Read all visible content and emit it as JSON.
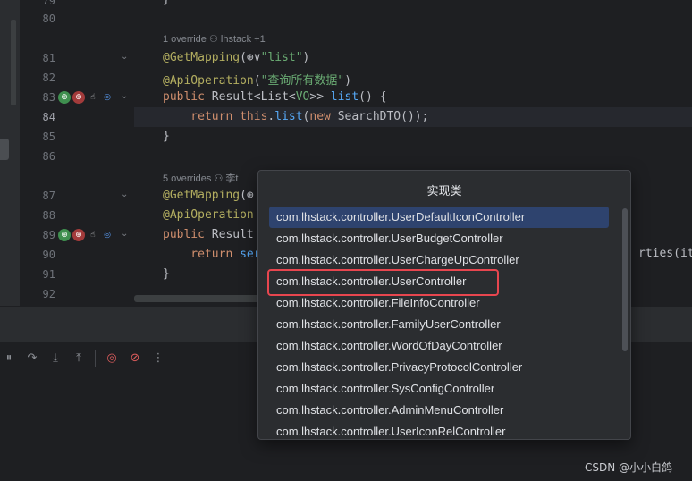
{
  "editor": {
    "lines": [
      {
        "num": "79",
        "kind": "code",
        "html_parts": [
          {
            "cls": "cn",
            "text": "}"
          }
        ]
      },
      {
        "num": "80"
      },
      {
        "num": "81",
        "parts": [
          {
            "cls": "ann",
            "text": "@GetMapping"
          },
          {
            "cls": "cn",
            "text": "("
          },
          {
            "cls": "cn",
            "text": "⊕∨"
          },
          {
            "cls": "str",
            "text": "\"list\""
          },
          {
            "cls": "cn",
            "text": ")"
          }
        ]
      },
      {
        "num": "82",
        "parts": [
          {
            "cls": "ann",
            "text": "@ApiOperation"
          },
          {
            "cls": "cn",
            "text": "("
          },
          {
            "cls": "str",
            "text": "\"查询所有数据\""
          },
          {
            "cls": "cn",
            "text": ")"
          }
        ]
      },
      {
        "num": "83",
        "parts": [
          {
            "cls": "kw",
            "text": "public "
          },
          {
            "cls": "type",
            "text": "Result<List<"
          },
          {
            "cls": "str",
            "text": "VO"
          },
          {
            "cls": "type",
            "text": ">> "
          },
          {
            "cls": "fn",
            "text": "list"
          },
          {
            "cls": "cn",
            "text": "() {"
          }
        ]
      },
      {
        "num": "84",
        "parts": [
          {
            "cls": "kw",
            "text": "    return this"
          },
          {
            "cls": "cn",
            "text": "."
          },
          {
            "cls": "fn",
            "text": "list"
          },
          {
            "cls": "cn",
            "text": "("
          },
          {
            "cls": "kw",
            "text": "new "
          },
          {
            "cls": "type",
            "text": "SearchDTO());"
          }
        ]
      },
      {
        "num": "85",
        "parts": [
          {
            "cls": "cn",
            "text": "}"
          }
        ]
      },
      {
        "num": "86"
      },
      {
        "num": "87",
        "parts": [
          {
            "cls": "ann",
            "text": "@GetMapping"
          },
          {
            "cls": "cn",
            "text": "(⊕"
          }
        ]
      },
      {
        "num": "88",
        "parts": [
          {
            "cls": "ann",
            "text": "@ApiOperation"
          }
        ]
      },
      {
        "num": "89",
        "parts": [
          {
            "cls": "kw",
            "text": "public "
          },
          {
            "cls": "type",
            "text": "Result"
          }
        ]
      },
      {
        "num": "90",
        "parts": [
          {
            "cls": "kw",
            "text": "    return "
          },
          {
            "cls": "fn",
            "text": "ser"
          }
        ]
      },
      {
        "num": "91",
        "parts": [
          {
            "cls": "cn",
            "text": "}"
          }
        ]
      },
      {
        "num": "92"
      }
    ],
    "inlay1": "1 override   ⚇ lhstack +1",
    "inlay2": "5 overrides   ⚇ 李t",
    "tail_text": "rties(ite"
  },
  "popup": {
    "title": "实现类",
    "items": [
      "com.lhstack.controller.UserDefaultIconController",
      "com.lhstack.controller.UserBudgetController",
      "com.lhstack.controller.UserChargeUpController",
      "com.lhstack.controller.UserController",
      "com.lhstack.controller.FileInfoController",
      "com.lhstack.controller.FamilyUserController",
      "com.lhstack.controller.WordOfDayController",
      "com.lhstack.controller.PrivacyProtocolController",
      "com.lhstack.controller.SysConfigController",
      "com.lhstack.controller.AdminMenuController",
      "com.lhstack.controller.UserIconRelController"
    ],
    "selected_index": 0,
    "highlighted_index": 3
  },
  "toolbar": {
    "icons": [
      "pause-icon",
      "step-over-icon",
      "step-into-icon",
      "step-out-icon",
      "view-breakpoints-icon",
      "mute-breakpoints-icon",
      "more-icon"
    ]
  },
  "watermark": "CSDN @小小白鸽",
  "colors": {
    "accent": "#2e436e",
    "highlight": "#e8464f"
  }
}
